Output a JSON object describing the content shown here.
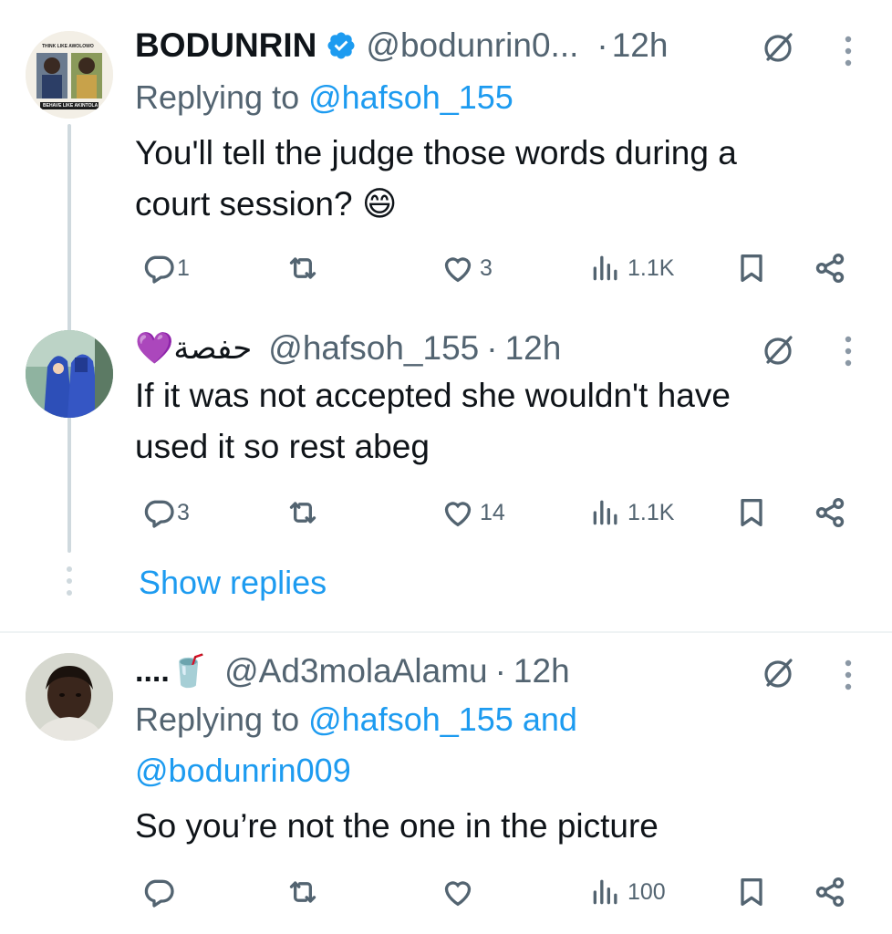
{
  "tweets": [
    {
      "name": "BODUNRIN",
      "verified": true,
      "handle": "@bodunrin0...",
      "sep": "·",
      "time": "12h",
      "replying_prefix": "Replying to ",
      "replying_handle": "@hafsoh_155",
      "text_line1": "You'll tell the judge those words during a",
      "text_line2": "court session? 😄",
      "replies": "1",
      "retweets": "",
      "likes": "3",
      "views": "1.1K",
      "avatar_top_text": "THINK LIKE AWOLOWO",
      "avatar_bottom_text": "BEHAVE LIKE AKINTOLA"
    },
    {
      "name": "💜حفصة",
      "handle": "@hafsoh_155",
      "sep": "·",
      "time": "12h",
      "text_line1": "If it was not accepted she wouldn't have",
      "text_line2": "used it so rest abeg",
      "replies": "3",
      "retweets": "",
      "likes": "14",
      "views": "1.1K"
    },
    {
      "name": "....🥤",
      "handle": "@Ad3molaAlamu",
      "sep": "·",
      "time": "12h",
      "replying_prefix": "Replying to ",
      "replying_handle": "@hafsoh_155 and",
      "replying_handle2": "@bodunrin009",
      "text_line1": "So you’re not the one in the picture",
      "replies": "",
      "retweets": "",
      "likes": "",
      "views": "100"
    }
  ],
  "show_replies": "Show replies",
  "colors": {
    "accent": "#1d9bf0",
    "secondary": "#536471",
    "verified": "#1d9bf0",
    "divider": "#eff3f4"
  },
  "icons": [
    "reply-icon",
    "retweet-icon",
    "like-icon",
    "views-icon",
    "bookmark-icon",
    "share-icon",
    "grok-icon",
    "more-icon",
    "verified-icon"
  ]
}
